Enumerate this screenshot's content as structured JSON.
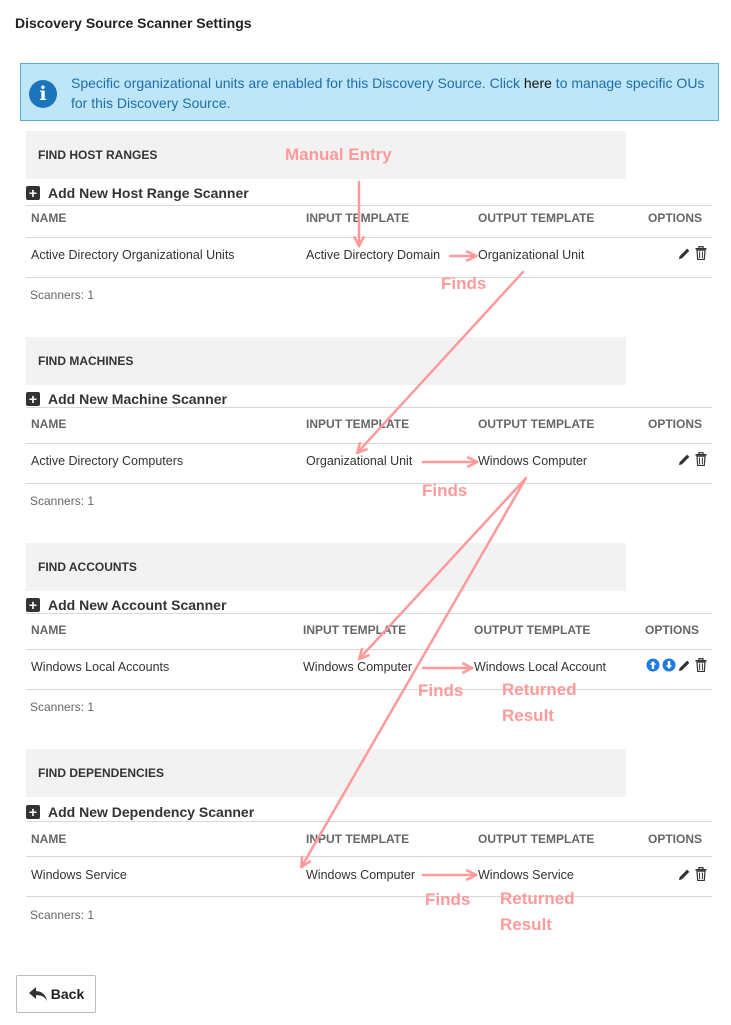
{
  "page": {
    "title": "Discovery Source Scanner Settings"
  },
  "info": {
    "text_before": "Specific organizational units are enabled for this Discovery Source. Click ",
    "link": "here",
    "text_after": " to manage specific OUs for this Discovery Source."
  },
  "columns": {
    "name": "NAME",
    "input": "INPUT TEMPLATE",
    "output": "OUTPUT TEMPLATE",
    "options": "OPTIONS"
  },
  "sections": [
    {
      "heading": "FIND HOST RANGES",
      "add_label": "Add New Host Range Scanner",
      "row": {
        "name": "Active Directory Organizational Units",
        "input": "Active Directory Domain",
        "output": "Organizational Unit"
      },
      "count": "Scanners: 1"
    },
    {
      "heading": "FIND MACHINES",
      "add_label": "Add New Machine Scanner",
      "row": {
        "name": "Active Directory Computers",
        "input": "Organizational Unit",
        "output": "Windows Computer"
      },
      "count": "Scanners: 1"
    },
    {
      "heading": "FIND ACCOUNTS",
      "add_label": "Add New Account Scanner",
      "row": {
        "name": "Windows Local Accounts",
        "input": "Windows Computer",
        "output": "Windows Local Account"
      },
      "count": "Scanners: 1"
    },
    {
      "heading": "FIND DEPENDENCIES",
      "add_label": "Add New Dependency Scanner",
      "row": {
        "name": "Windows Service",
        "input": "Windows Computer",
        "output": "Windows Service"
      },
      "count": "Scanners: 1"
    }
  ],
  "annotations": {
    "manual_entry": "Manual Entry",
    "finds": "Finds",
    "returned_result": "Returned Result"
  },
  "buttons": {
    "back": "Back"
  },
  "colors": {
    "annotation": "#ff9a9a",
    "info_bg": "#bfe6f8",
    "info_icon": "#1b75bb",
    "move_icon": "#1f7be0"
  },
  "icons": {
    "info": "info-icon",
    "add": "plus-square-icon",
    "edit": "pencil-icon",
    "delete": "trash-icon",
    "move_up": "arrow-up-circle-icon",
    "move_down": "arrow-down-circle-icon",
    "back": "reply-arrow-icon"
  }
}
